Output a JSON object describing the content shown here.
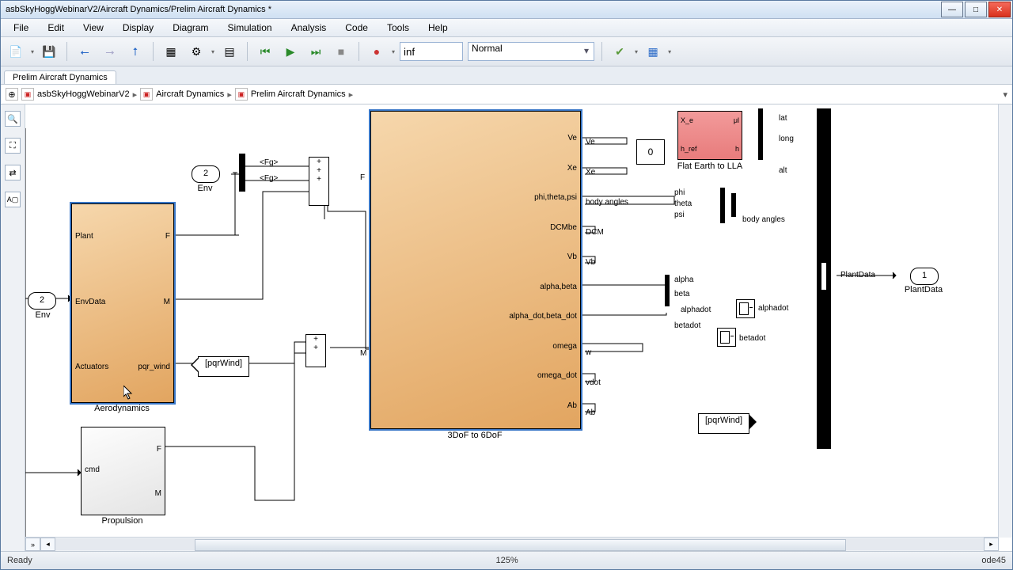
{
  "window_title": "asbSkyHoggWebinarV2/Aircraft Dynamics/Prelim Aircraft Dynamics *",
  "menus": [
    "File",
    "Edit",
    "View",
    "Display",
    "Diagram",
    "Simulation",
    "Analysis",
    "Code",
    "Tools",
    "Help"
  ],
  "stop_time": "inf",
  "sim_mode": "Normal",
  "tab_label": "Prelim Aircraft Dynamics",
  "breadcrumb": [
    "asbSkyHoggWebinarV2",
    "Aircraft Dynamics",
    "Prelim Aircraft Dynamics"
  ],
  "status_left": "Ready",
  "status_zoom": "125%",
  "status_solver": "ode45",
  "aero": {
    "name": "Aerodynamics",
    "in": [
      "Plant",
      "EnvData",
      "Actuators"
    ],
    "out": [
      "F",
      "M",
      "pqr_wind"
    ]
  },
  "propulsion": {
    "name": "Propulsion",
    "in": [
      "cmd"
    ],
    "out": [
      "F",
      "M"
    ]
  },
  "env_inport": {
    "num": "2",
    "name": "Env"
  },
  "fg_labels": [
    "<Fg>",
    "<Fg>"
  ],
  "threesix": {
    "name": "3DoF to 6DoF",
    "in_label": "F",
    "in_label2": "M",
    "outs": [
      "Ve",
      "Xe",
      "phi,theta,psi",
      "DCMbe",
      "Vb",
      "alpha,beta",
      "alpha_dot,beta_dot",
      "omega",
      "omega_dot",
      "Ab"
    ]
  },
  "flat_earth": {
    "name": "Flat Earth to LLA",
    "in": [
      "X_e",
      "h_ref"
    ],
    "out": [
      "μl",
      "h"
    ]
  },
  "const_zero": "0",
  "outport1": {
    "num": "1",
    "name": "PlantData"
  },
  "plantdata_label": "PlantData",
  "bus_right_labels": [
    "Ve",
    "Xe",
    "body angles",
    "DCM",
    "Vb",
    "w",
    "vdot",
    "Ab"
  ],
  "lla_out_labels": [
    "lat",
    "long",
    "alt"
  ],
  "angle_mux_labels": [
    "phi",
    "theta",
    "psi"
  ],
  "angle_mux_out": "body angles",
  "alphabeta_labels": [
    "alpha",
    "beta"
  ],
  "dot_labels_in": [
    "alphadot",
    "betadot"
  ],
  "dot_labels_out": [
    "alphadot",
    "betadot"
  ],
  "tag_from": "[pqrWind]",
  "tag_goto": "[pqrWind]",
  "colors": {
    "orange": "#e2a560",
    "pink": "#ee8c8c"
  }
}
